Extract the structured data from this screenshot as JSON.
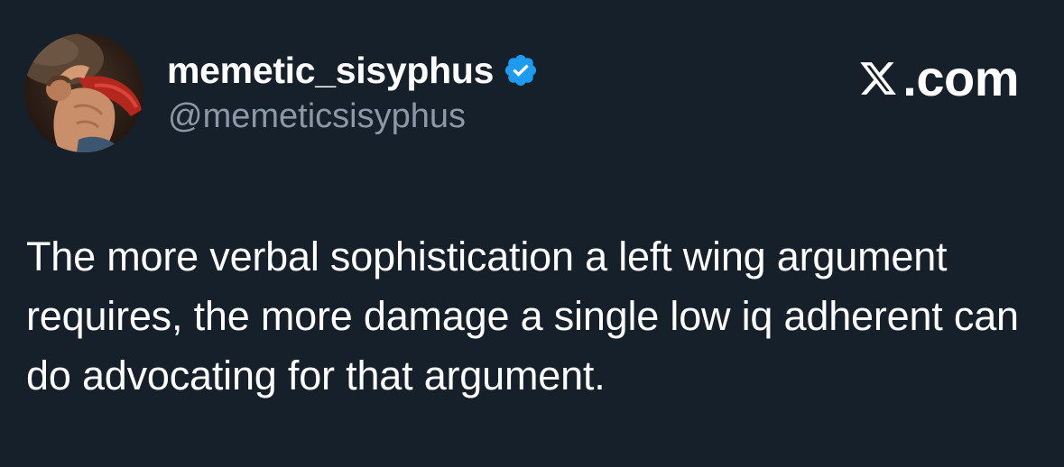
{
  "author": {
    "display_name": "memetic_sisyphus",
    "handle": "@memeticsisyphus",
    "verified": true,
    "avatar_icon": "painting-avatar-icon"
  },
  "brand": {
    "label": ".com",
    "logo_icon": "x-logo-icon"
  },
  "tweet": {
    "text": "The more verbal sophistication a left wing argument requires, the more damage a single low iq adherent can do advocating for that argument."
  },
  "colors": {
    "background": "#15202b",
    "primary_text": "#ffffff",
    "secondary_text": "#8b98a5",
    "verified_badge": "#1d9bf0"
  }
}
